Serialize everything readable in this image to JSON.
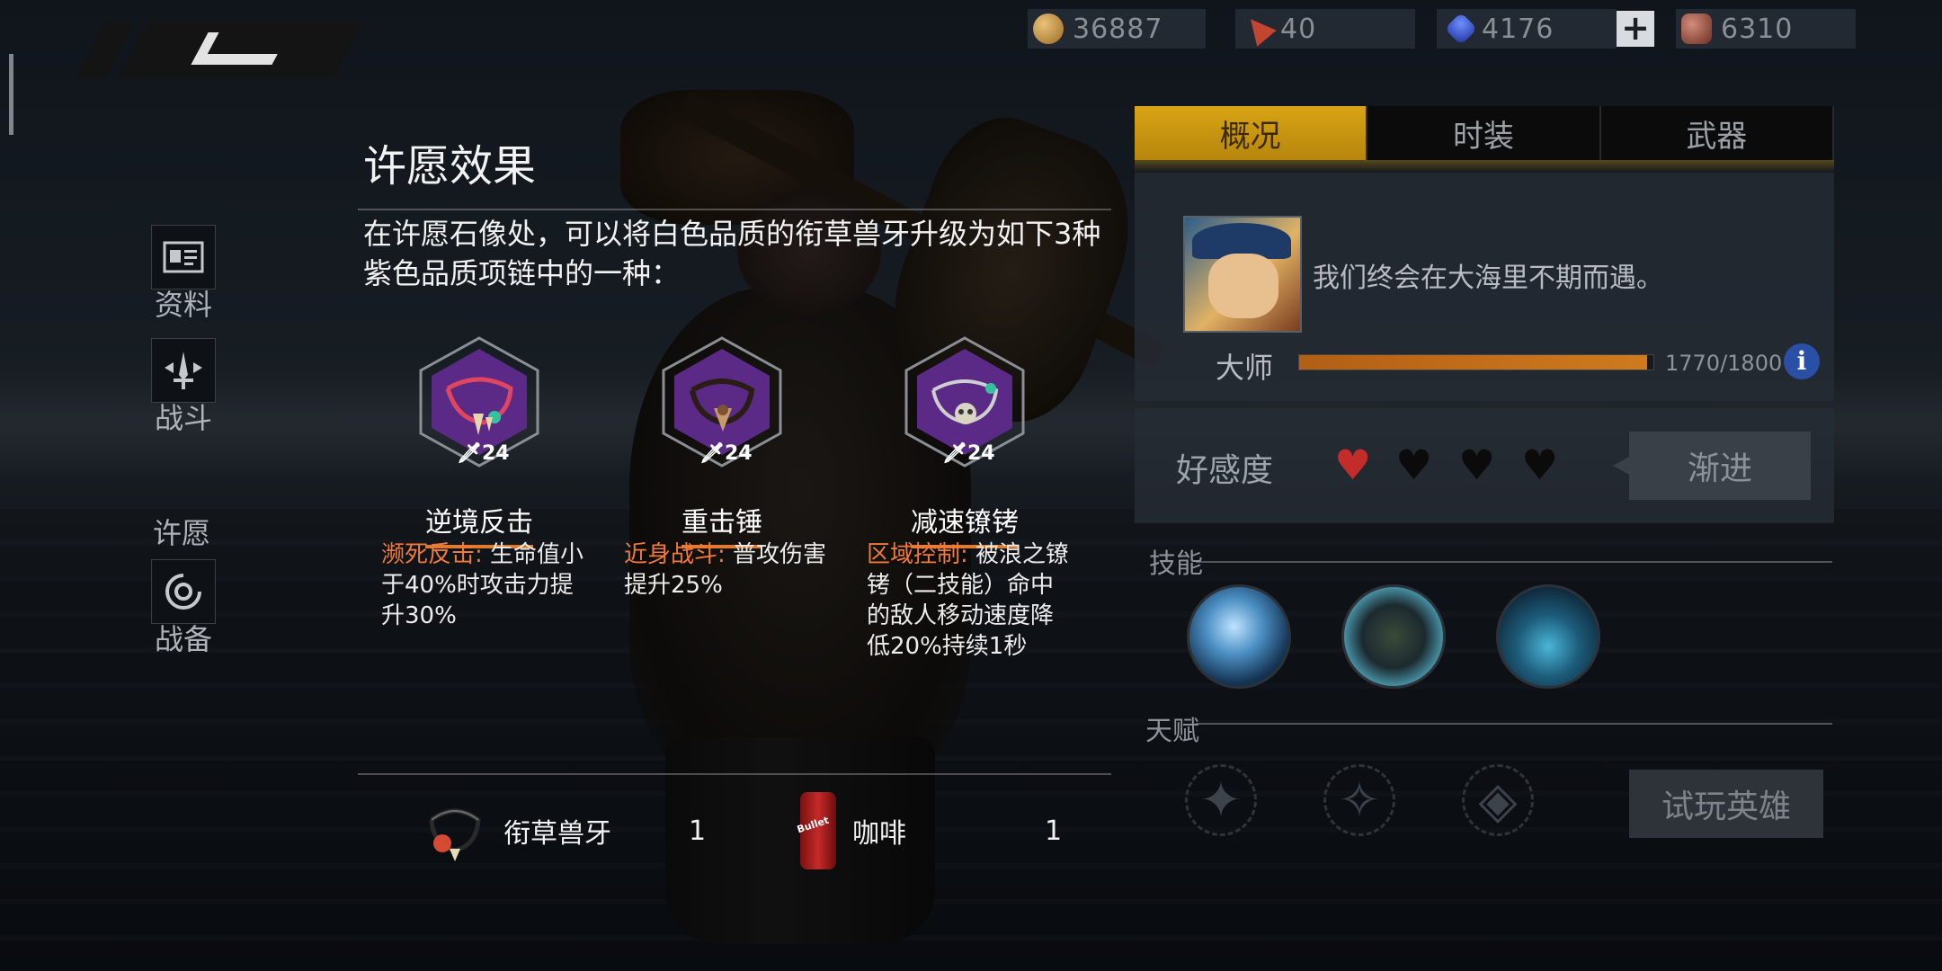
{
  "currencies": {
    "gold": {
      "value": "36887",
      "icon": "gold-coin-icon"
    },
    "flag": {
      "value": "40",
      "icon": "red-flag-icon"
    },
    "gem": {
      "value": "4176",
      "icon": "blue-gem-icon"
    },
    "plus_label": "+",
    "ore": {
      "value": "6310",
      "icon": "red-ore-icon"
    }
  },
  "side_nav": {
    "items": [
      {
        "label": "资料",
        "icon": "profile-card-icon"
      },
      {
        "label": "战斗",
        "icon": "sword-icon"
      },
      {
        "label": "战备",
        "icon": "gear-disc-icon"
      }
    ],
    "wish_label": "许愿"
  },
  "wish": {
    "title": "许愿效果",
    "description": "在许愿石像处，可以将白色品质的衔草兽牙升级为如下3种紫色品质项链中的一种：",
    "necklaces": [
      {
        "name": "逆境反击",
        "level": "24",
        "tag": "濒死反击:",
        "effect": " 生命值小于40%时攻击力提升30%"
      },
      {
        "name": "重击锤",
        "level": "24",
        "tag": "近身战斗:",
        "effect": " 普攻伤害提升25%"
      },
      {
        "name": "减速镣铐",
        "level": "24",
        "tag": "区域控制:",
        "effect": " 被浪之镣铐（二技能）命中的敌人移动速度降低20%持续1秒"
      }
    ],
    "cost": [
      {
        "name": "衔草兽牙",
        "qty": "1",
        "icon": "fang-necklace-icon"
      },
      {
        "name": "咖啡",
        "qty": "1",
        "icon": "coffee-can-icon"
      }
    ]
  },
  "hero_panel": {
    "tabs": [
      "概况",
      "时装",
      "武器"
    ],
    "active_tab": 0,
    "quote": "我们终会在大海里不期而遇。",
    "rank": "大师",
    "xp_text": "1770/1800",
    "xp_current": 1770,
    "xp_max": 1800,
    "favor_label": "好感度",
    "favor_hearts": [
      true,
      false,
      false,
      false
    ],
    "advance_label": "渐进",
    "skills_label": "技能",
    "talents_label": "天赋",
    "trial_label": "试玩英雄"
  },
  "colors": {
    "accent_gold": "#d8a414",
    "tag_orange": "#f07a3a",
    "necklace_purple": "#5b2a86",
    "heart_red": "#c42b2b",
    "xp_orange": "#c06a18"
  }
}
